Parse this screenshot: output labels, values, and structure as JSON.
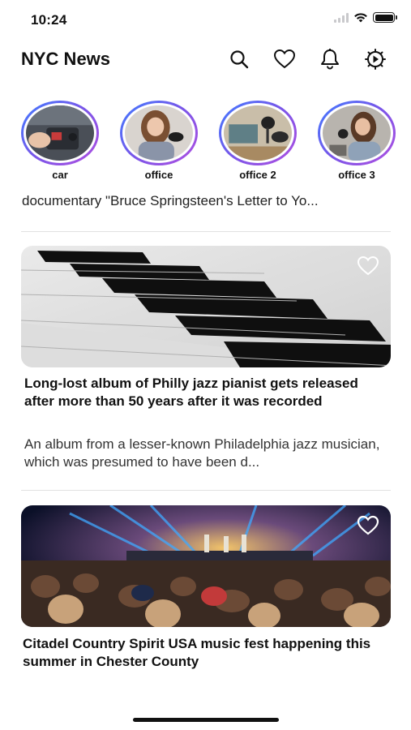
{
  "status_bar": {
    "time": "10:24"
  },
  "header": {
    "title": "NYC News",
    "icons": [
      "search-icon",
      "heart-icon",
      "bell-icon",
      "settings-icon"
    ]
  },
  "stories": [
    {
      "label": "car"
    },
    {
      "label": "office"
    },
    {
      "label": "office 2"
    },
    {
      "label": "office 3"
    }
  ],
  "teaser": {
    "text": "documentary \"Bruce Springsteen's Letter to Yo..."
  },
  "articles": [
    {
      "title": "Long-lost album of Philly jazz pianist gets released after more than 50 years after it was recorded",
      "description": "An album from a lesser-known Philadelphia jazz musician, which was presumed to have been d...",
      "favorited": false
    },
    {
      "title": "Citadel Country Spirit USA music fest happening this summer in Chester County",
      "description": "",
      "favorited": false
    }
  ],
  "colors": {
    "story_ring_start": "#3f7bff",
    "story_ring_end": "#b04fe0",
    "text": "#111111"
  }
}
